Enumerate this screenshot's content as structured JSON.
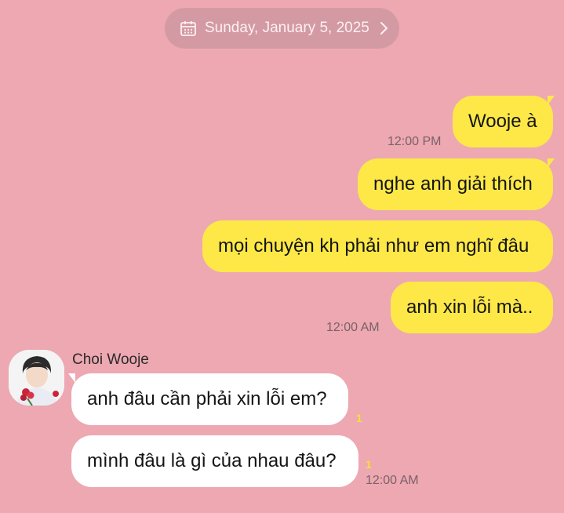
{
  "date_header": {
    "label": "Sunday, January 5, 2025",
    "icon_left": "calendar-icon",
    "icon_right": "chevron-right-icon"
  },
  "colors": {
    "background": "#eda8b2",
    "outgoing_bubble": "#fde848",
    "incoming_bubble": "#ffffff",
    "read_count": "#f3e03a"
  },
  "outgoing_messages": [
    {
      "text": "Wooje à",
      "time": "12:00 PM"
    },
    {
      "text": "nghe anh giải thích"
    },
    {
      "text": "mọi chuyện kh phải như em nghĩ đâu"
    },
    {
      "text": "anh xin lỗi mà..",
      "time": "12:00 AM"
    }
  ],
  "contact": {
    "name": "Choi Wooje",
    "avatar": "avatar-photo"
  },
  "incoming_messages": [
    {
      "text": "anh đâu cần phải xin lỗi em?",
      "unread": "1"
    },
    {
      "text": "mình đâu là gì của nhau đâu?",
      "unread": "1",
      "time": "12:00 AM"
    }
  ]
}
